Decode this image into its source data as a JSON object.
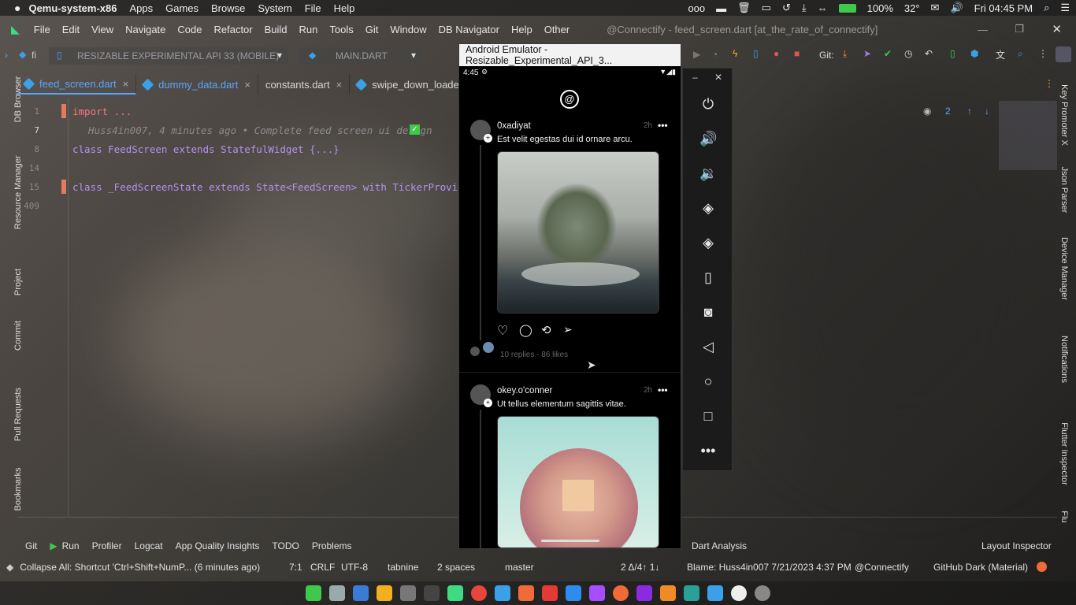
{
  "system_bar": {
    "app": "Qemu-system-x86",
    "menus": [
      "Apps",
      "Games",
      "Browse",
      "System",
      "File",
      "Help"
    ],
    "battery": "100%",
    "temperature": "32°",
    "clock": "Fri 04:45 PM"
  },
  "ide_menu": {
    "items": [
      "File",
      "Edit",
      "View",
      "Navigate",
      "Code",
      "Refactor",
      "Build",
      "Run",
      "Tools",
      "Git",
      "Window",
      "DB Navigator",
      "Help",
      "Other"
    ],
    "window_title": "@Connectify - feed_screen.dart [at_the_rate_of_connectify]"
  },
  "toolbar": {
    "project_short": "fi",
    "device_combo": "RESIZABLE EXPERIMENTAL API 33 (MOBILE)",
    "run_config": "MAIN.DART",
    "git_label": "Git:"
  },
  "tabs": [
    {
      "label": "feed_screen.dart",
      "active": true
    },
    {
      "label": "dummy_data.dart",
      "active": false
    },
    {
      "label": "constants.dart",
      "active": false
    },
    {
      "label": "swipe_down_loader.",
      "active": false
    }
  ],
  "editor": {
    "lines": [
      {
        "num": "1",
        "code": "import ..."
      },
      {
        "num": "7",
        "code": "Huss4in007, 4 minutes ago • Complete feed screen ui design"
      },
      {
        "num": "8",
        "code": "class FeedScreen extends StatefulWidget {...}"
      },
      {
        "num": "14",
        "code": ""
      },
      {
        "num": "15",
        "code": "class _FeedScreenState extends State<FeedScreen> with TickerProviderSt"
      },
      {
        "num": "409",
        "code": ""
      }
    ],
    "inspection": "2"
  },
  "left_sidebar": [
    "DB Browser",
    "Resource Manager",
    "Project",
    "Commit",
    "Pull Requests",
    "Bookmarks"
  ],
  "right_sidebar": [
    "Key Promoter X",
    "Json Parser",
    "Device Manager",
    "Notifications",
    "Flutter Inspector",
    "Flu"
  ],
  "bottom_tools": {
    "left": [
      "Git",
      "Run",
      "Profiler",
      "Logcat",
      "App Quality Insights",
      "TODO",
      "Problems"
    ],
    "dart_analysis": "Dart Analysis",
    "layout_inspector": "Layout Inspector"
  },
  "status_bar": {
    "message": "Collapse All: Shortcut 'Ctrl+Shift+NumP... (6 minutes ago)",
    "position": "7:1",
    "line_sep": "CRLF",
    "encoding": "UTF-8",
    "tabnine": "tabnine",
    "indent": "2 spaces",
    "branch": "master",
    "git_changes": "2 Δ/4↑ 1↓",
    "blame": "Blame: Huss4in007 7/21/2023 4:37 PM",
    "project": "@Connectify",
    "theme": "GitHub Dark (Material)"
  },
  "emulator": {
    "title": "Android Emulator - Resizable_Experimental_API_3...",
    "phone_time": "4:45",
    "posts": [
      {
        "user": "0xadiyat",
        "time": "2h",
        "text": "Est velit egestas dui id ornare arcu.",
        "stats": "10 replies · 86 likes"
      },
      {
        "user": "okey.o'conner",
        "time": "2h",
        "text": "Ut tellus elementum sagittis vitae."
      }
    ]
  }
}
